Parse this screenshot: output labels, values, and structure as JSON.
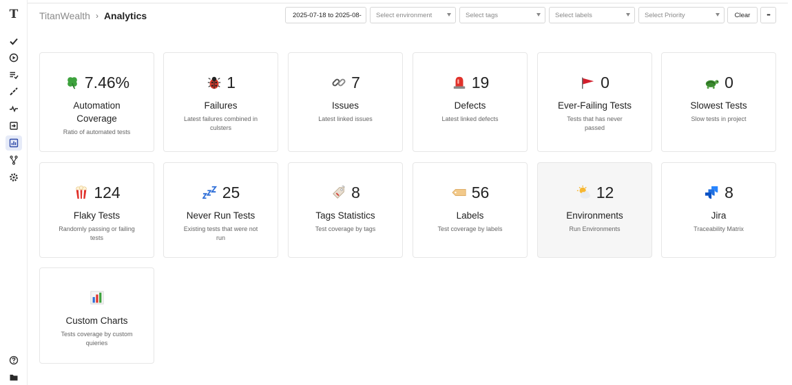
{
  "app": {
    "logo": "T"
  },
  "breadcrumb": {
    "app_name": "TitanWealth",
    "separator": "›",
    "page": "Analytics"
  },
  "filters": {
    "date_range": "2025-07-18 to 2025-08-",
    "environment_placeholder": "Select environment",
    "tags_placeholder": "Select tags",
    "labels_placeholder": "Select labels",
    "priority_placeholder": "Select Priority",
    "clear_label": "Clear",
    "more_label": "•••"
  },
  "sidebar": {
    "items": [
      {
        "name": "tests-icon"
      },
      {
        "name": "runs-icon"
      },
      {
        "name": "plans-icon"
      },
      {
        "name": "steps-icon"
      },
      {
        "name": "pulse-icon"
      },
      {
        "name": "import-icon"
      },
      {
        "name": "analytics-icon",
        "active": true
      },
      {
        "name": "branches-icon"
      },
      {
        "name": "settings-icon"
      }
    ],
    "bottom": [
      {
        "name": "help-icon"
      },
      {
        "name": "folder-icon"
      }
    ]
  },
  "cards": [
    {
      "id": "automation-coverage",
      "icon": "clover-icon",
      "value": "7.46%",
      "title": "Automation Coverage",
      "desc": "Ratio of automated tests"
    },
    {
      "id": "failures",
      "icon": "ladybug-icon",
      "value": "1",
      "title": "Failures",
      "desc": "Latest failures combined in culsters"
    },
    {
      "id": "issues",
      "icon": "link-icon",
      "value": "7",
      "title": "Issues",
      "desc": "Latest linked issues"
    },
    {
      "id": "defects",
      "icon": "siren-icon",
      "value": "19",
      "title": "Defects",
      "desc": "Latest linked defects"
    },
    {
      "id": "ever-failing-tests",
      "icon": "red-flag-icon",
      "value": "0",
      "title": "Ever-Failing Tests",
      "desc": "Tests that has never passed"
    },
    {
      "id": "slowest-tests",
      "icon": "turtle-icon",
      "value": "0",
      "title": "Slowest Tests",
      "desc": "Slow tests in project"
    },
    {
      "id": "flaky-tests",
      "icon": "popcorn-icon",
      "value": "124",
      "title": "Flaky Tests",
      "desc": "Randomly passing or failing tests"
    },
    {
      "id": "never-run-tests",
      "icon": "zzz-icon",
      "value": "25",
      "title": "Never Run Tests",
      "desc": "Existing tests that were not run"
    },
    {
      "id": "tags-statistics",
      "icon": "tag-icon",
      "value": "8",
      "title": "Tags Statistics",
      "desc": "Test coverage by tags"
    },
    {
      "id": "labels",
      "icon": "label-icon",
      "value": "56",
      "title": "Labels",
      "desc": "Test coverage by labels"
    },
    {
      "id": "environments",
      "icon": "sun-cloud-icon",
      "value": "12",
      "title": "Environments",
      "desc": "Run Environments"
    },
    {
      "id": "jira",
      "icon": "jira-icon",
      "value": "8",
      "title": "Jira",
      "desc": "Traceability Matrix"
    },
    {
      "id": "custom-charts",
      "icon": "bar-chart-icon",
      "value": "",
      "title": "Custom Charts",
      "desc": "Tests coverage by custom quieries"
    }
  ]
}
